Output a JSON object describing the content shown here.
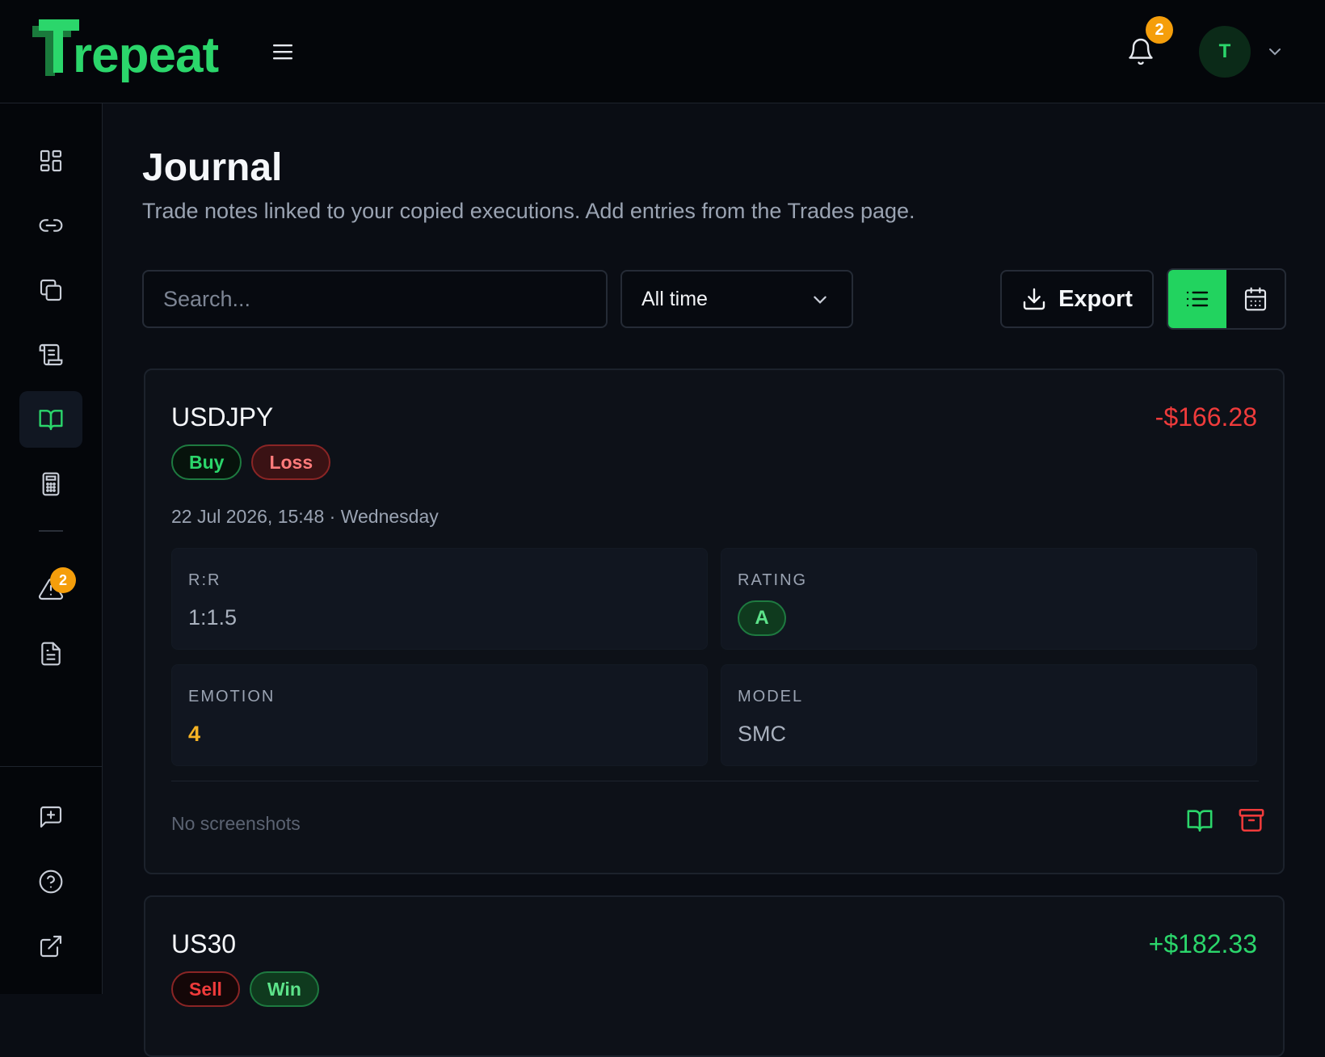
{
  "brand": {
    "logo_text": "repeat",
    "accent": "#2bd66b"
  },
  "header": {
    "notifications_count": "2",
    "avatar_initial": "T"
  },
  "sidebar": {
    "alerts_badge": "2",
    "items": [
      {
        "icon": "dashboard-icon"
      },
      {
        "icon": "link-icon"
      },
      {
        "icon": "copy-icon"
      },
      {
        "icon": "scroll-icon"
      },
      {
        "icon": "book-open-icon",
        "active": true
      },
      {
        "icon": "calculator-icon"
      },
      {
        "icon": "alert-triangle-icon"
      },
      {
        "icon": "document-icon"
      },
      {
        "icon": "message-plus-icon"
      },
      {
        "icon": "help-circle-icon"
      },
      {
        "icon": "external-link-icon"
      }
    ]
  },
  "page": {
    "title": "Journal",
    "subtitle": "Trade notes linked to your copied executions. Add entries from the Trades page."
  },
  "toolbar": {
    "search_placeholder": "Search...",
    "period_value": "All time",
    "export_label": "Export",
    "active_view": "list"
  },
  "entries": [
    {
      "symbol": "USDJPY",
      "pnl": "-$166.28",
      "side": "Buy",
      "outcome": "Loss",
      "datetime": "22 Jul 2026, 15:48 · Wednesday",
      "rr_label": "R:R",
      "rr_value": "1:1.5",
      "rating_label": "RATING",
      "rating_value": "A",
      "emotion_label": "EMOTION",
      "emotion_value": "4",
      "model_label": "MODEL",
      "model_value": "SMC",
      "screenshots_text": "No screenshots"
    },
    {
      "symbol": "US30",
      "pnl": "+$182.33",
      "side": "Sell",
      "outcome": "Win"
    }
  ]
}
